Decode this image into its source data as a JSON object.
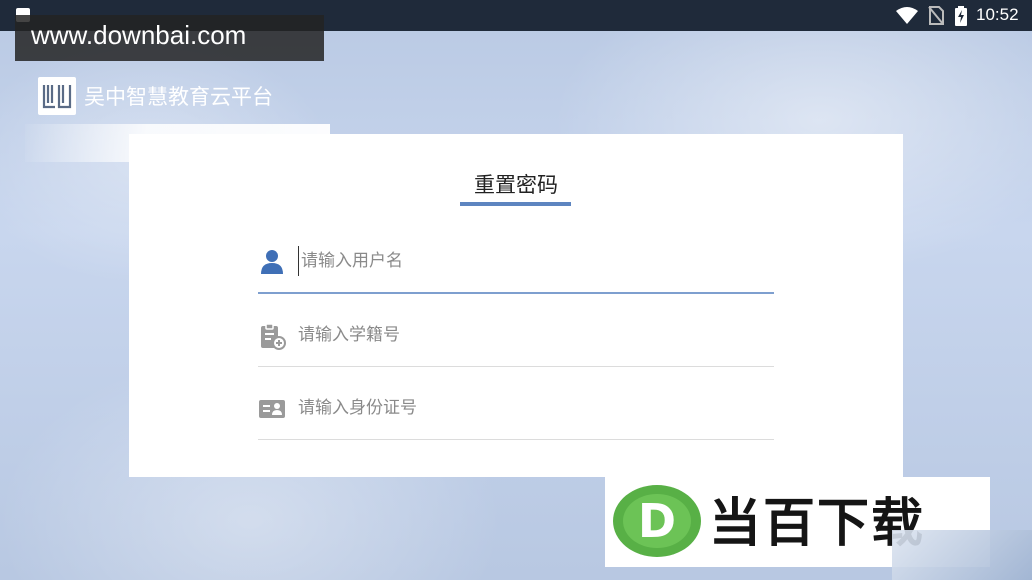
{
  "status_bar": {
    "time": "10:52"
  },
  "watermark_top": "www.downbai.com",
  "brand": {
    "name": "吴中智慧教育云平台",
    "logo_icon": "book-icon"
  },
  "form": {
    "title": "重置密码",
    "fields": [
      {
        "icon": "user-icon",
        "placeholder": "请输入用户名",
        "value": ""
      },
      {
        "icon": "student-id-icon",
        "placeholder": "请输入学籍号",
        "value": ""
      },
      {
        "icon": "id-card-icon",
        "placeholder": "请输入身份证号",
        "value": ""
      }
    ]
  },
  "watermark_bottom": {
    "letter": "D",
    "text": "当百下载"
  },
  "colors": {
    "accent": "#5d85c0",
    "icon_blue": "#3f6fb6",
    "logo_green": "#58b046"
  }
}
